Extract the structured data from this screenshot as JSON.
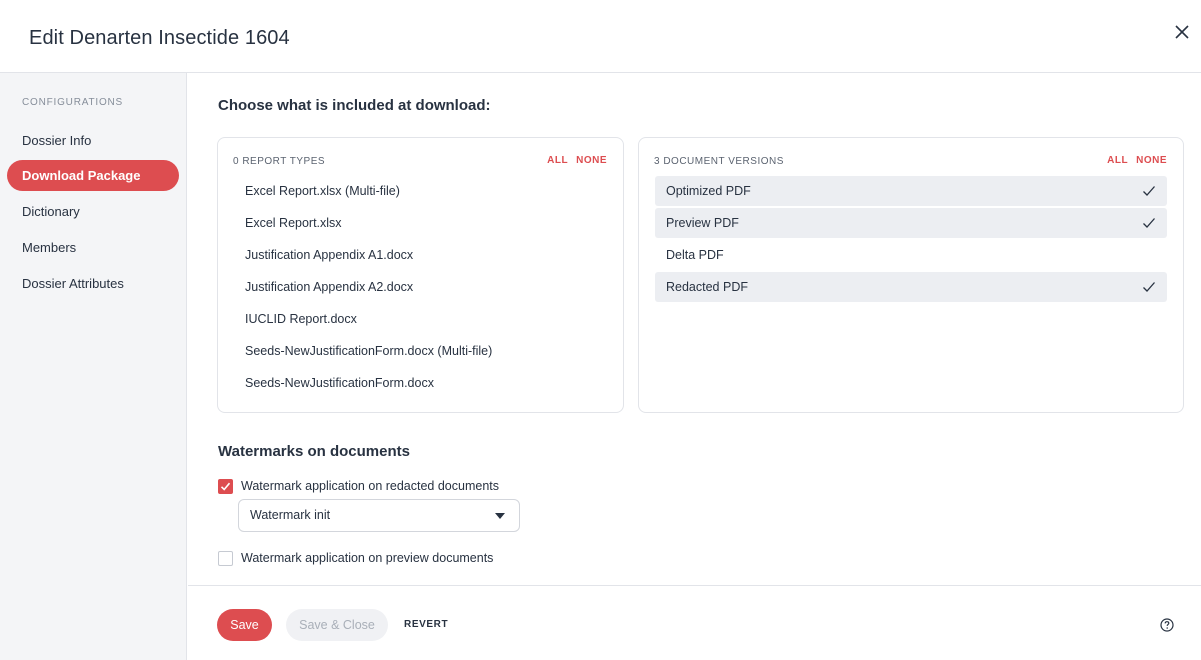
{
  "dialog": {
    "title": "Edit Denarten Insectide 1604"
  },
  "sidebar": {
    "heading": "CONFIGURATIONS",
    "items": [
      {
        "label": "Dossier Info",
        "active": false
      },
      {
        "label": "Download Package",
        "active": true
      },
      {
        "label": "Dictionary",
        "active": false
      },
      {
        "label": "Members",
        "active": false
      },
      {
        "label": "Dossier Attributes",
        "active": false
      }
    ]
  },
  "main": {
    "section_title": "Choose what is included at download:",
    "report_types": {
      "heading": "0 REPORT TYPES",
      "all_label": "ALL",
      "none_label": "NONE",
      "items": [
        {
          "label": "Excel Report.xlsx (Multi-file)",
          "selected": false
        },
        {
          "label": "Excel Report.xlsx",
          "selected": false
        },
        {
          "label": "Justification Appendix A1.docx",
          "selected": false
        },
        {
          "label": "Justification Appendix A2.docx",
          "selected": false
        },
        {
          "label": "IUCLID Report.docx",
          "selected": false
        },
        {
          "label": "Seeds-NewJustificationForm.docx (Multi-file)",
          "selected": false
        },
        {
          "label": "Seeds-NewJustificationForm.docx",
          "selected": false
        }
      ]
    },
    "document_versions": {
      "heading": "3 DOCUMENT VERSIONS",
      "all_label": "ALL",
      "none_label": "NONE",
      "items": [
        {
          "label": "Optimized PDF",
          "selected": true
        },
        {
          "label": "Preview PDF",
          "selected": true
        },
        {
          "label": "Delta PDF",
          "selected": false
        },
        {
          "label": "Redacted PDF",
          "selected": true
        }
      ]
    },
    "watermarks": {
      "title": "Watermarks on documents",
      "redacted_label": "Watermark application on redacted documents",
      "redacted_checked": true,
      "redacted_select_value": "Watermark init",
      "preview_label": "Watermark application on preview documents",
      "preview_checked": false
    }
  },
  "footer": {
    "save_label": "Save",
    "save_close_label": "Save & Close",
    "revert_label": "REVERT"
  },
  "colors": {
    "accent": "#dd4d50",
    "text": "#283241",
    "muted": "#868e9a",
    "selected_bg": "#eceef2"
  },
  "icons": {
    "close": "close-icon",
    "check": "check-icon",
    "help": "help-icon",
    "caret": "chevron-down-icon"
  }
}
